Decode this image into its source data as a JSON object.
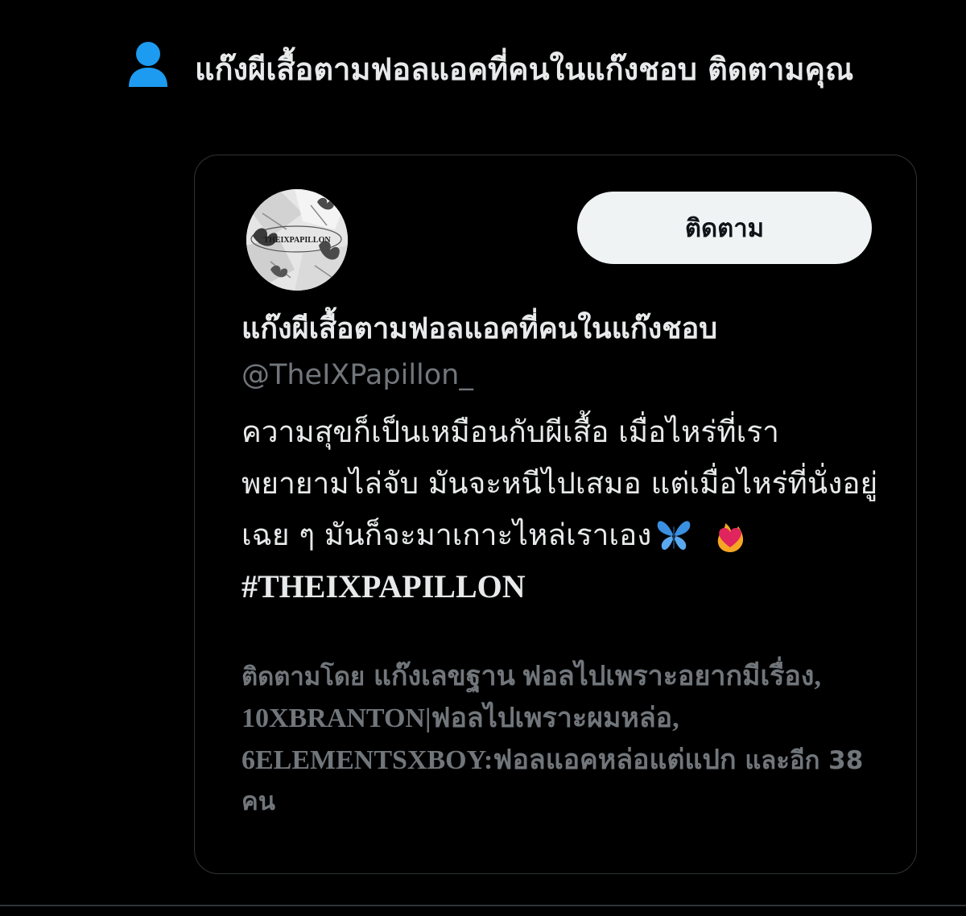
{
  "notification": {
    "icon": "person-icon",
    "name": "แก๊งผีเสื้อตามฟอลแอคที่คนในแก๊งชอบ",
    "action": " ติดตามคุณ"
  },
  "card": {
    "avatar_text": "THEIXPAPILLON",
    "follow_label": "ติดตาม",
    "display_name": "แก๊งผีเสื้อตามฟอลแอคที่คนในแก๊งชอบ",
    "handle": "@TheIXPapillon_",
    "bio_text": "ความสุขก็เป็นเหมือนกับผีเสื้อ เมื่อไหร่ที่เราพยายามไล่จับ มันจะหนีไปเสมอ แต่เมื่อไหร่ที่นั่งอยู่เฉย ๆ มันก็จะมาเกาะไหล่เราเอง",
    "bio_emojis": [
      "butterfly-emoji",
      "heart-on-fire-emoji"
    ],
    "bio_hashtag": "#THEIXPAPILLON",
    "followed_by_prefix": "ติดตามโดย ",
    "followed_by_names": "แก๊งเลขฐาน ฟอลไปเพราะอยากมีเรื่อง, 10XBRANTON|ฟอลไปเพราะผมหล่อ, 6ELEMENTSXBOY:ฟอลแอคหล่อแต่แปก",
    "followed_by_suffix": " และอีก 38 คน"
  },
  "colors": {
    "background": "#000000",
    "text_primary": "#e7e9ea",
    "text_secondary": "#71767b",
    "accent_icon": "#1d9bf0",
    "border": "#2f3336",
    "button_bg": "#eff3f4"
  }
}
